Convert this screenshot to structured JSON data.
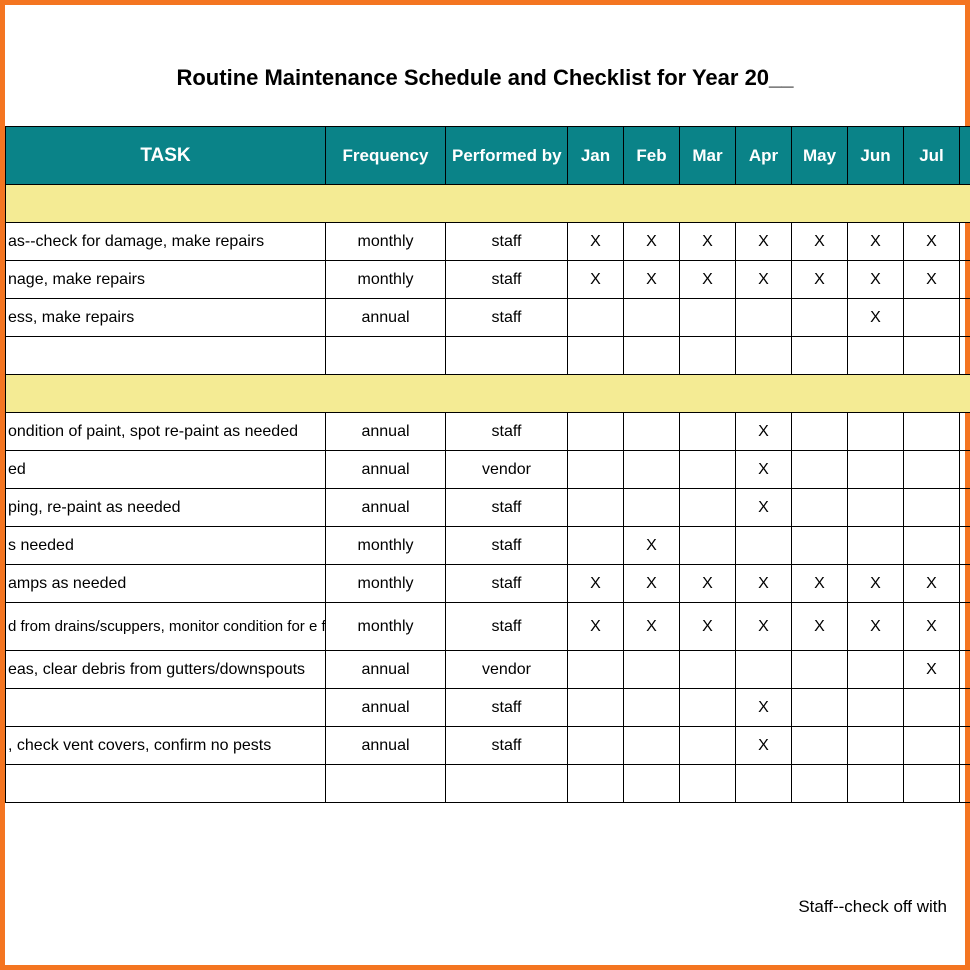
{
  "title": "Routine Maintenance Schedule and Checklist for Year 20__",
  "footer": "Staff--check off with",
  "headers": {
    "task": "TASK",
    "frequency": "Frequency",
    "performed_by": "Performed by",
    "months": [
      "Jan",
      "Feb",
      "Mar",
      "Apr",
      "May",
      "Jun",
      "Jul"
    ]
  },
  "chart_data": {
    "type": "table",
    "columns": [
      "TASK",
      "Frequency",
      "Performed by",
      "Jan",
      "Feb",
      "Mar",
      "Apr",
      "May",
      "Jun",
      "Jul"
    ],
    "sections": [
      {
        "rows": [
          {
            "task": "as--check for damage, make repairs",
            "frequency": "monthly",
            "performed_by": "staff",
            "marks": [
              "X",
              "X",
              "X",
              "X",
              "X",
              "X",
              "X"
            ]
          },
          {
            "task": "nage, make repairs",
            "frequency": "monthly",
            "performed_by": "staff",
            "marks": [
              "X",
              "X",
              "X",
              "X",
              "X",
              "X",
              "X"
            ]
          },
          {
            "task": "ess, make repairs",
            "frequency": "annual",
            "performed_by": "staff",
            "marks": [
              "",
              "",
              "",
              "",
              "",
              "X",
              ""
            ]
          },
          {
            "task": "",
            "frequency": "",
            "performed_by": "",
            "marks": [
              "",
              "",
              "",
              "",
              "",
              "",
              ""
            ]
          }
        ]
      },
      {
        "rows": [
          {
            "task": "ondition of paint, spot re-paint as needed",
            "frequency": "annual",
            "performed_by": "staff",
            "marks": [
              "",
              "",
              "",
              "X",
              "",
              "",
              ""
            ]
          },
          {
            "task": "ed",
            "frequency": "annual",
            "performed_by": "vendor",
            "marks": [
              "",
              "",
              "",
              "X",
              "",
              "",
              ""
            ]
          },
          {
            "task": "ping, re-paint as needed",
            "frequency": "annual",
            "performed_by": "staff",
            "marks": [
              "",
              "",
              "",
              "X",
              "",
              "",
              ""
            ]
          },
          {
            "task": "s needed",
            "frequency": "monthly",
            "performed_by": "staff",
            "marks": [
              "",
              "X",
              "",
              "",
              "",
              "",
              ""
            ]
          },
          {
            "task": "amps as needed",
            "frequency": "monthly",
            "performed_by": "staff",
            "marks": [
              "X",
              "X",
              "X",
              "X",
              "X",
              "X",
              "X"
            ]
          },
          {
            "task": "d from drains/scuppers, monitor condition for e flashing",
            "frequency": "monthly",
            "performed_by": "staff",
            "marks": [
              "X",
              "X",
              "X",
              "X",
              "X",
              "X",
              "X"
            ],
            "multiline": true
          },
          {
            "task": "eas, clear debris from gutters/downspouts",
            "frequency": "annual",
            "performed_by": "vendor",
            "marks": [
              "",
              "",
              "",
              "",
              "",
              "",
              "X"
            ]
          },
          {
            "task": "",
            "frequency": "annual",
            "performed_by": "staff",
            "marks": [
              "",
              "",
              "",
              "X",
              "",
              "",
              ""
            ]
          },
          {
            "task": ", check vent covers, confirm no pests",
            "frequency": "annual",
            "performed_by": "staff",
            "marks": [
              "",
              "",
              "",
              "X",
              "",
              "",
              ""
            ]
          },
          {
            "task": "",
            "frequency": "",
            "performed_by": "",
            "marks": [
              "",
              "",
              "",
              "",
              "",
              "",
              ""
            ]
          }
        ]
      }
    ]
  }
}
